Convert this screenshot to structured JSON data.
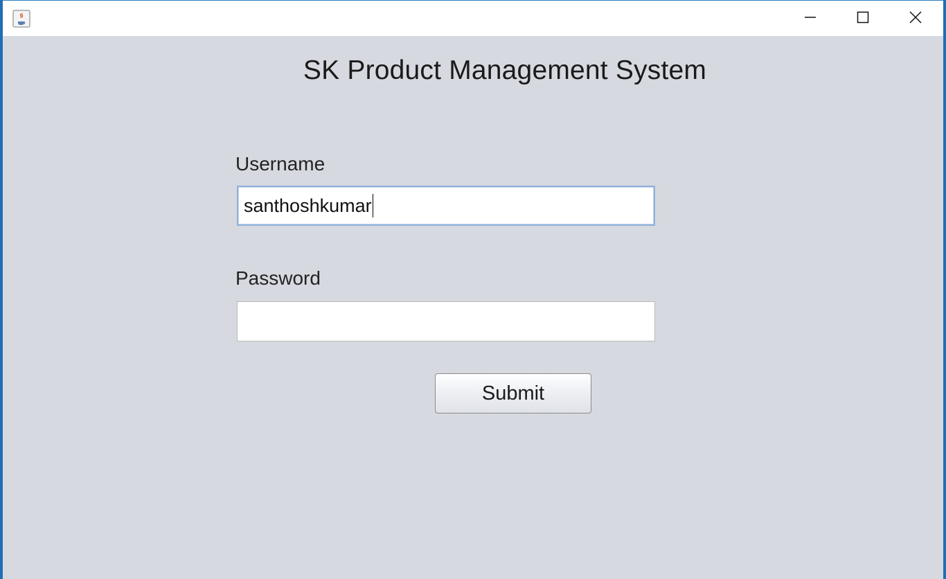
{
  "window": {
    "title": "",
    "icon": "java-cup-icon",
    "controls": {
      "minimize_icon": "minimize-icon",
      "maximize_icon": "maximize-icon",
      "close_icon": "close-icon"
    }
  },
  "form": {
    "title": "SK Product Management System",
    "username_label": "Username",
    "username_value": "santhoshkumar",
    "password_label": "Password",
    "password_value": "",
    "submit_label": "Submit"
  },
  "colors": {
    "window_background": "#d7d9e0",
    "titlebar_background": "#ffffff",
    "focus_border": "#8fb1da",
    "desktop_edge": "#1f6fb2"
  }
}
